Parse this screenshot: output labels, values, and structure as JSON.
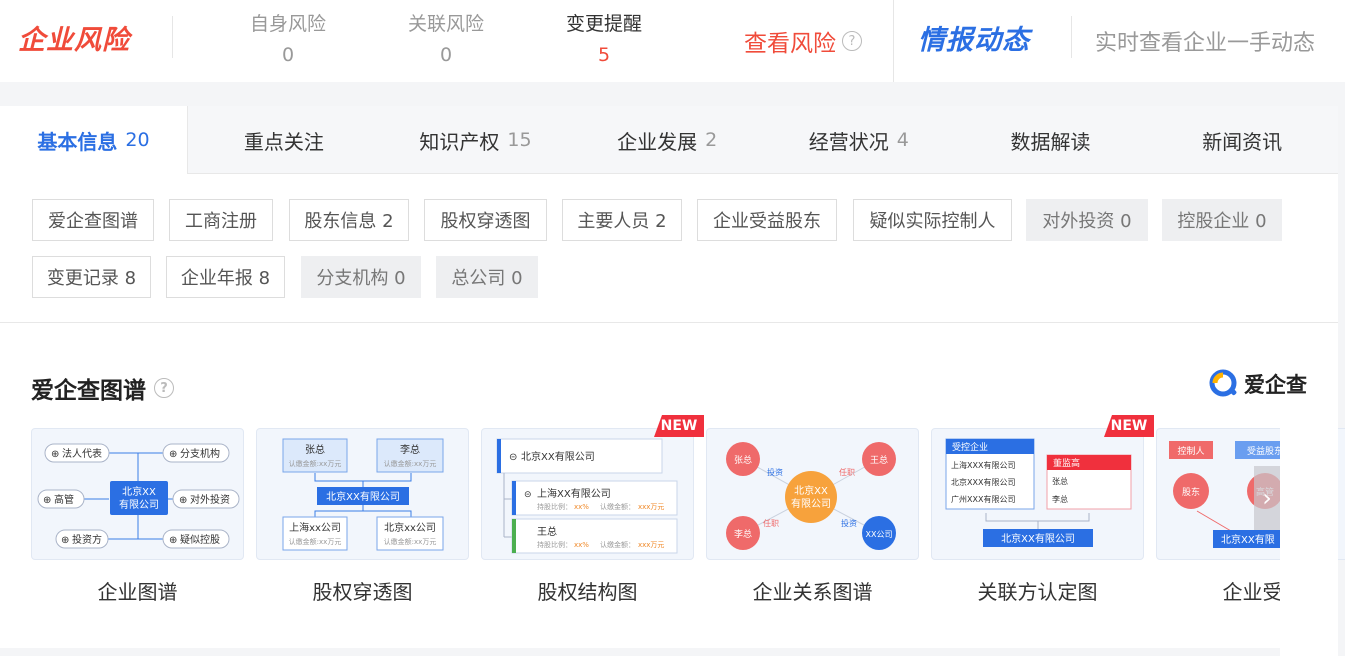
{
  "header": {
    "logo": "企业风险",
    "stats": [
      {
        "label": "自身风险",
        "value": "0"
      },
      {
        "label": "关联风险",
        "value": "0"
      },
      {
        "label": "变更提醒",
        "value": "5"
      }
    ],
    "risk_link": "查看风险",
    "logo2": "情报动态",
    "slogan": "实时查看企业一手动态"
  },
  "tabs": [
    {
      "label": "基本信息",
      "count": "20"
    },
    {
      "label": "重点关注",
      "count": ""
    },
    {
      "label": "知识产权",
      "count": "15"
    },
    {
      "label": "企业发展",
      "count": "2"
    },
    {
      "label": "经营状况",
      "count": "4"
    },
    {
      "label": "数据解读",
      "count": ""
    },
    {
      "label": "新闻资讯",
      "count": ""
    }
  ],
  "chips": [
    "爱企查图谱",
    "工商注册",
    "股东信息 2",
    "股权穿透图",
    "主要人员 2",
    "企业受益股东",
    "疑似实际控制人",
    "对外投资 0",
    "控股企业 0",
    "变更记录 8",
    "企业年报 8",
    "分支机构 0",
    "总公司 0"
  ],
  "section": {
    "title": "爱企查图谱",
    "brand": "爱企查"
  },
  "new_label": "NEW",
  "cards": [
    {
      "label": "企业图谱"
    },
    {
      "label": "股权穿透图"
    },
    {
      "label": "股权结构图"
    },
    {
      "label": "企业关系图谱"
    },
    {
      "label": "关联方认定图"
    },
    {
      "label": "企业受益"
    }
  ],
  "thumb": {
    "c1": {
      "center": [
        "北京XX",
        "有限公司"
      ],
      "nodes": [
        "法人代表",
        "分支机构",
        "高管",
        "对外投资",
        "投资方",
        "疑似控股"
      ]
    },
    "c2": {
      "top": [
        "张总",
        "李总"
      ],
      "sub": "认缴金额:xx万元",
      "center": "北京XX有限公司",
      "bottom": [
        "上海xx公司",
        "北京xx公司"
      ]
    },
    "c3": {
      "root": "北京XX有限公司",
      "child1": "上海XX有限公司",
      "child2": "王总",
      "meta1": "持股比例：",
      "meta1v": "xx%",
      "meta2": "认缴金额：",
      "meta2v": "xxx万元"
    },
    "c4": {
      "center": [
        "北京XX",
        "有限公司"
      ],
      "p1": "张总",
      "p2": "王总",
      "p3": "李总",
      "p4": "XX公司",
      "e1": "投资",
      "e2": "任职",
      "e3": "任职",
      "e4": "投资"
    },
    "c5": {
      "box1": "受控企业",
      "rows": [
        "上海XXX有限公司",
        "北京XXX有限公司",
        "广州XXX有限公司"
      ],
      "box2": "董监高",
      "rows2": [
        "张总",
        "李总"
      ],
      "bottom": "北京XX有限公司"
    },
    "c6": {
      "a": "控制人",
      "b": "受益股东",
      "c": "股东",
      "d": "高管",
      "bottom": "北京XX有限"
    }
  },
  "colors": {
    "red": "#f04b3a",
    "blue": "#2b6fe3"
  },
  "icons": {
    "help": "question-circle-icon",
    "next": "chevron-right-icon",
    "brand": "aiqicha-logo-icon"
  }
}
